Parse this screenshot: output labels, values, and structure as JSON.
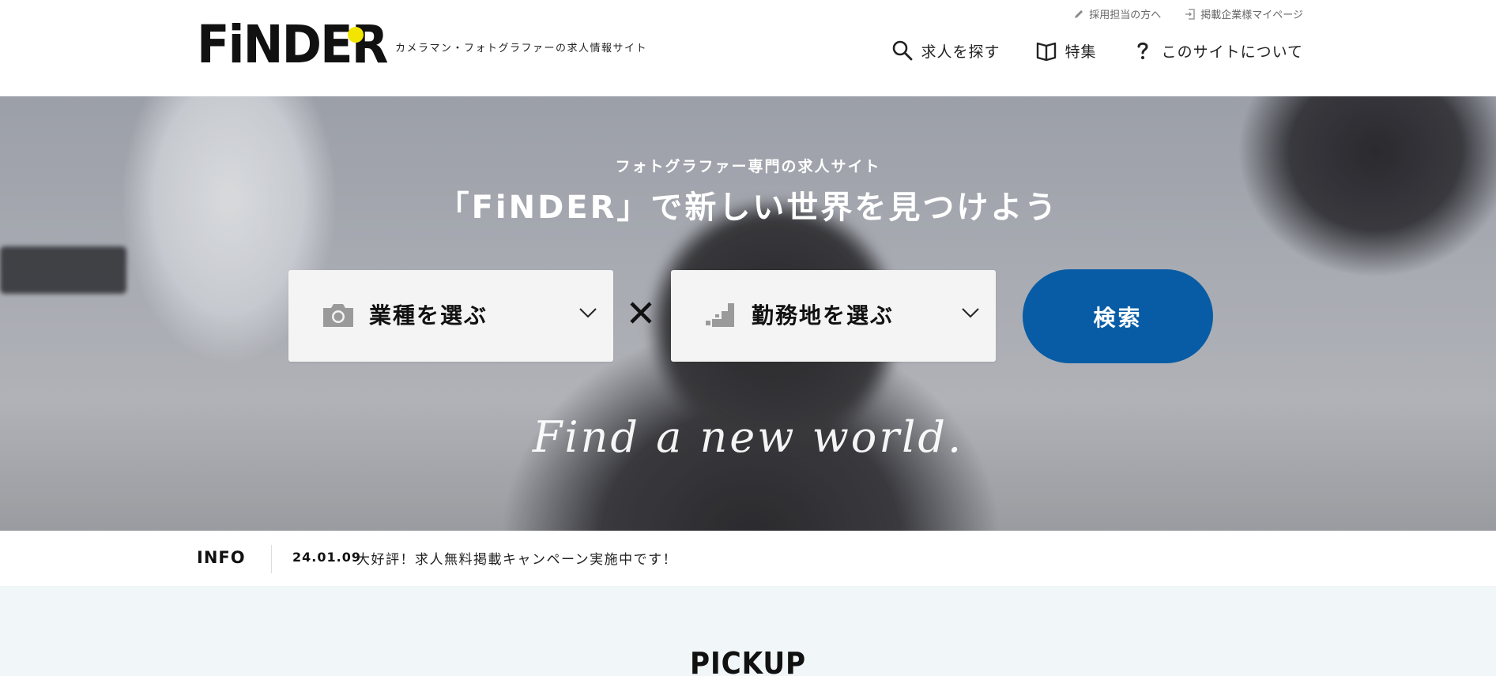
{
  "header": {
    "logo_text": "FiNDER",
    "tagline": "カメラマン・フォトグラファーの求人情報サイト",
    "util_links": [
      {
        "label": "採用担当の方へ",
        "icon": "pencil-icon"
      },
      {
        "label": "掲載企業様マイページ",
        "icon": "login-icon"
      }
    ],
    "nav": [
      {
        "label": "求人を探す",
        "icon": "search-icon"
      },
      {
        "label": "特集",
        "icon": "book-icon"
      },
      {
        "label": "このサイトについて",
        "icon": "question-icon"
      }
    ]
  },
  "hero": {
    "subtitle": "フォトグラファー専門の求人サイト",
    "title": "「FiNDER」で新しい世界を見つけよう",
    "job_select": {
      "label": "業種を選ぶ",
      "icon": "camera-icon"
    },
    "area_select": {
      "label": "勤務地を選ぶ",
      "icon": "map-icon"
    },
    "search_label": "検索",
    "script_text": "Find a new world."
  },
  "info": {
    "label": "INFO",
    "date": "24.01.09",
    "text": "大好評！求人無料掲載キャンペーン実施中です！"
  },
  "pickup": {
    "title": "PICKUP"
  },
  "colors": {
    "accent": "#075ca5",
    "logo_dot": "#f2e600",
    "pickup_bg": "#f1f6f8"
  }
}
